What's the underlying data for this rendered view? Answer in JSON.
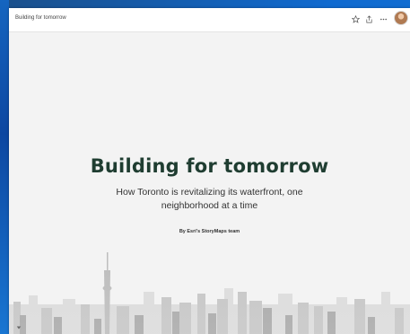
{
  "header": {
    "title": "Building for tomorrow",
    "icons": [
      "star-icon",
      "share-icon",
      "more-icon"
    ]
  },
  "story": {
    "title": "Building for tomorrow",
    "subtitle": "How Toronto is revitalizing its waterfront, one neighborhood at a time",
    "byline": "By Esri's StoryMaps team"
  },
  "colors": {
    "title": "#1f3d31",
    "background": "#f3f3f3",
    "desktop": "#0f6ad0"
  }
}
